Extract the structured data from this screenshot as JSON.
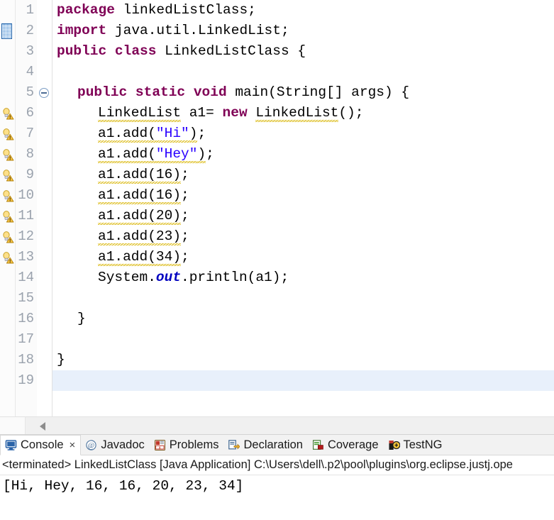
{
  "editor": {
    "lines": [
      {
        "n": "1",
        "indent": 0,
        "marker": "none",
        "fold": false,
        "warn": false,
        "tokens": [
          {
            "t": "package",
            "c": "kw"
          },
          {
            "t": " ",
            "c": "plain"
          },
          {
            "t": "linkedListClass;",
            "c": "plain"
          }
        ]
      },
      {
        "n": "2",
        "indent": 0,
        "marker": "import-block",
        "fold": false,
        "warn": false,
        "tokens": [
          {
            "t": "import",
            "c": "kw"
          },
          {
            "t": " ",
            "c": "plain"
          },
          {
            "t": "java.util.LinkedList;",
            "c": "plain"
          }
        ]
      },
      {
        "n": "3",
        "indent": 0,
        "marker": "none",
        "fold": false,
        "warn": false,
        "tokens": [
          {
            "t": "public",
            "c": "kw"
          },
          {
            "t": " ",
            "c": "plain"
          },
          {
            "t": "class",
            "c": "kw"
          },
          {
            "t": " LinkedListClass {",
            "c": "plain"
          }
        ]
      },
      {
        "n": "4",
        "indent": 0,
        "marker": "none",
        "fold": false,
        "warn": false,
        "tokens": []
      },
      {
        "n": "5",
        "indent": 1,
        "marker": "none",
        "fold": true,
        "warn": false,
        "tokens": [
          {
            "t": "public",
            "c": "kw"
          },
          {
            "t": " ",
            "c": "plain"
          },
          {
            "t": "static",
            "c": "kw"
          },
          {
            "t": " ",
            "c": "plain"
          },
          {
            "t": "void",
            "c": "kw"
          },
          {
            "t": " main(String[] args) {",
            "c": "plain"
          }
        ]
      },
      {
        "n": "6",
        "indent": 2,
        "marker": "warning",
        "fold": false,
        "warn": true,
        "tokens": [
          {
            "t": "LinkedList",
            "c": "squiggle"
          },
          {
            "t": " a1= ",
            "c": "plain"
          },
          {
            "t": "new",
            "c": "kw"
          },
          {
            "t": " ",
            "c": "plain"
          },
          {
            "t": "LinkedList",
            "c": "squiggle"
          },
          {
            "t": "();",
            "c": "plain"
          }
        ]
      },
      {
        "n": "7",
        "indent": 2,
        "marker": "warning",
        "fold": false,
        "warn": true,
        "tokens": [
          {
            "t": "a1",
            "c": "squiggle"
          },
          {
            "t": ".add(",
            "c": "squiggle"
          },
          {
            "t": "\"Hi\"",
            "c": "str-sq"
          },
          {
            "t": ")",
            "c": "squiggle"
          },
          {
            "t": ";",
            "c": "plain"
          }
        ]
      },
      {
        "n": "8",
        "indent": 2,
        "marker": "warning",
        "fold": false,
        "warn": true,
        "tokens": [
          {
            "t": "a1",
            "c": "squiggle"
          },
          {
            "t": ".add(",
            "c": "squiggle"
          },
          {
            "t": "\"Hey\"",
            "c": "str-sq"
          },
          {
            "t": ")",
            "c": "squiggle"
          },
          {
            "t": ";",
            "c": "plain"
          }
        ]
      },
      {
        "n": "9",
        "indent": 2,
        "marker": "warning",
        "fold": false,
        "warn": true,
        "tokens": [
          {
            "t": "a1.add(16)",
            "c": "squiggle"
          },
          {
            "t": ";",
            "c": "plain"
          }
        ]
      },
      {
        "n": "10",
        "indent": 2,
        "marker": "warning",
        "fold": false,
        "warn": true,
        "tokens": [
          {
            "t": "a1.add(16)",
            "c": "squiggle"
          },
          {
            "t": ";",
            "c": "plain"
          }
        ]
      },
      {
        "n": "11",
        "indent": 2,
        "marker": "warning",
        "fold": false,
        "warn": true,
        "tokens": [
          {
            "t": "a1.add(20)",
            "c": "squiggle"
          },
          {
            "t": ";",
            "c": "plain"
          }
        ]
      },
      {
        "n": "12",
        "indent": 2,
        "marker": "warning",
        "fold": false,
        "warn": true,
        "tokens": [
          {
            "t": "a1.add(23)",
            "c": "squiggle"
          },
          {
            "t": ";",
            "c": "plain"
          }
        ]
      },
      {
        "n": "13",
        "indent": 2,
        "marker": "warning",
        "fold": false,
        "warn": true,
        "tokens": [
          {
            "t": "a1.add(34)",
            "c": "squiggle"
          },
          {
            "t": ";",
            "c": "plain"
          }
        ]
      },
      {
        "n": "14",
        "indent": 2,
        "marker": "none",
        "fold": false,
        "warn": false,
        "tokens": [
          {
            "t": "System.",
            "c": "plain"
          },
          {
            "t": "out",
            "c": "stat"
          },
          {
            "t": ".println(a1);",
            "c": "plain"
          }
        ]
      },
      {
        "n": "15",
        "indent": 0,
        "marker": "none",
        "fold": false,
        "warn": false,
        "tokens": []
      },
      {
        "n": "16",
        "indent": 1,
        "marker": "none",
        "fold": false,
        "warn": false,
        "tokens": [
          {
            "t": "}",
            "c": "plain"
          }
        ]
      },
      {
        "n": "17",
        "indent": 0,
        "marker": "none",
        "fold": false,
        "warn": false,
        "tokens": []
      },
      {
        "n": "18",
        "indent": 0,
        "marker": "none",
        "fold": false,
        "warn": false,
        "tokens": [
          {
            "t": "}",
            "c": "plain"
          }
        ]
      },
      {
        "n": "19",
        "indent": 0,
        "marker": "none",
        "fold": false,
        "warn": false,
        "current": true,
        "tokens": []
      }
    ],
    "scrollbar": {
      "left_arrow_icon": "triangle-left-icon"
    }
  },
  "console": {
    "tabs": [
      {
        "label": "Console",
        "icon": "console-monitor-icon",
        "active": true,
        "closable": true
      },
      {
        "label": "Javadoc",
        "icon": "at-sign-icon",
        "active": false,
        "closable": false
      },
      {
        "label": "Problems",
        "icon": "problems-error-icon",
        "active": false,
        "closable": false
      },
      {
        "label": "Declaration",
        "icon": "declaration-icon",
        "active": false,
        "closable": false
      },
      {
        "label": "Coverage",
        "icon": "coverage-icon",
        "active": false,
        "closable": false
      },
      {
        "label": "TestNG",
        "icon": "testng-icon",
        "active": false,
        "closable": false
      }
    ],
    "close_glyph": "×",
    "status_line": "<terminated> LinkedListClass [Java Application] C:\\Users\\dell\\.p2\\pool\\plugins\\org.eclipse.justj.ope",
    "output_lines": [
      "[Hi, Hey, 16, 16, 20, 23, 34]"
    ]
  },
  "colors": {
    "keyword": "#7f0055",
    "string": "#2a00ff",
    "static_field": "#0000c0",
    "warning_squiggle": "#d8b400",
    "current_line": "#e8f0fb",
    "line_number": "#9aa2ad",
    "tab_bar_bg": "#f2f2f2"
  }
}
